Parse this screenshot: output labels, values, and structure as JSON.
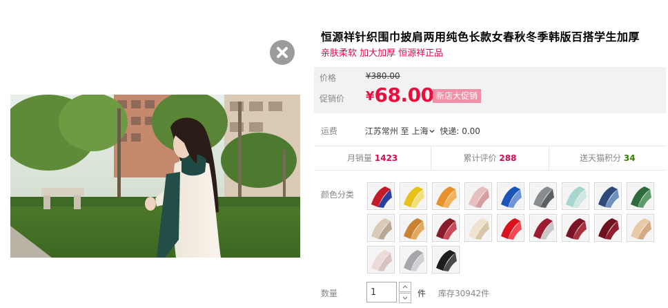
{
  "product": {
    "title": "恒源祥针织围巾披肩两用纯色长款女春秋冬季韩版百搭学生加厚",
    "subtitle": "亲肤柔软 加大加厚 恒源祥正品"
  },
  "price": {
    "original_label": "价格",
    "original_yen": "¥",
    "original_value": "380.00",
    "promo_label": "促销价",
    "promo_yen": "¥",
    "promo_value": "68.00",
    "promo_tag": "新店大促销"
  },
  "shipping": {
    "label": "运费",
    "origin": "江苏常州",
    "to": "至",
    "destination": "上海",
    "express": "快递: 0.00"
  },
  "stats": {
    "monthly_sales_label": "月销量",
    "monthly_sales_value": "1423",
    "reviews_label": "累计评价",
    "reviews_value": "288",
    "points_label": "送天猫积分",
    "points_value": "34"
  },
  "colors": {
    "label": "颜色分类",
    "swatches": [
      {
        "name": "swatch-royal-red",
        "c1": "#c41b2b",
        "c2": "#2b3fa1"
      },
      {
        "name": "swatch-yellow",
        "c1": "#e6c21a",
        "c2": "#f0e27a"
      },
      {
        "name": "swatch-orange",
        "c1": "#e8902a",
        "c2": "#f3b25f"
      },
      {
        "name": "swatch-pink",
        "c1": "#e7bfc0",
        "c2": "#d69ea0"
      },
      {
        "name": "swatch-blue",
        "c1": "#1b55b8",
        "c2": "#6f95d6"
      },
      {
        "name": "swatch-grey",
        "c1": "#8a8d90",
        "c2": "#5d6063"
      },
      {
        "name": "swatch-mint",
        "c1": "#a8d6cf",
        "c2": "#cfe8e3"
      },
      {
        "name": "swatch-denim",
        "c1": "#2e4a7a",
        "c2": "#6f8fbd"
      },
      {
        "name": "swatch-green",
        "c1": "#2f6b3c",
        "c2": "#5f9a6b"
      },
      {
        "name": "swatch-beige",
        "c1": "#d9cbb7",
        "c2": "#b7a892"
      },
      {
        "name": "swatch-caramel",
        "c1": "#c9822f",
        "c2": "#e2a85e"
      },
      {
        "name": "swatch-burgundy-mix",
        "c1": "#8a1b2b",
        "c2": "#c94b5a"
      },
      {
        "name": "swatch-cream",
        "c1": "#efe3cf",
        "c2": "#d8c6a8"
      },
      {
        "name": "swatch-red",
        "c1": "#d7121e",
        "c2": "#f04a53"
      },
      {
        "name": "swatch-wine",
        "c1": "#9b1c31",
        "c2": "#c7c7c7"
      },
      {
        "name": "swatch-maroon",
        "c1": "#7a1426",
        "c2": "#a8303f"
      },
      {
        "name": "swatch-dark-red",
        "c1": "#6e1220",
        "c2": "#8f1e2e"
      },
      {
        "name": "swatch-camel",
        "c1": "#e8c9a8",
        "c2": "#d5a983"
      },
      {
        "name": "swatch-light-pink",
        "c1": "#eadbd6",
        "c2": "#d7c3bd"
      },
      {
        "name": "swatch-silver",
        "c1": "#a5a7aa",
        "c2": "#cfd0d2"
      },
      {
        "name": "swatch-black",
        "c1": "#1c1c1c",
        "c2": "#4a4a4a"
      }
    ]
  },
  "quantity": {
    "label": "数量",
    "value": "1",
    "unit": "件",
    "stock": "库存30942件"
  }
}
